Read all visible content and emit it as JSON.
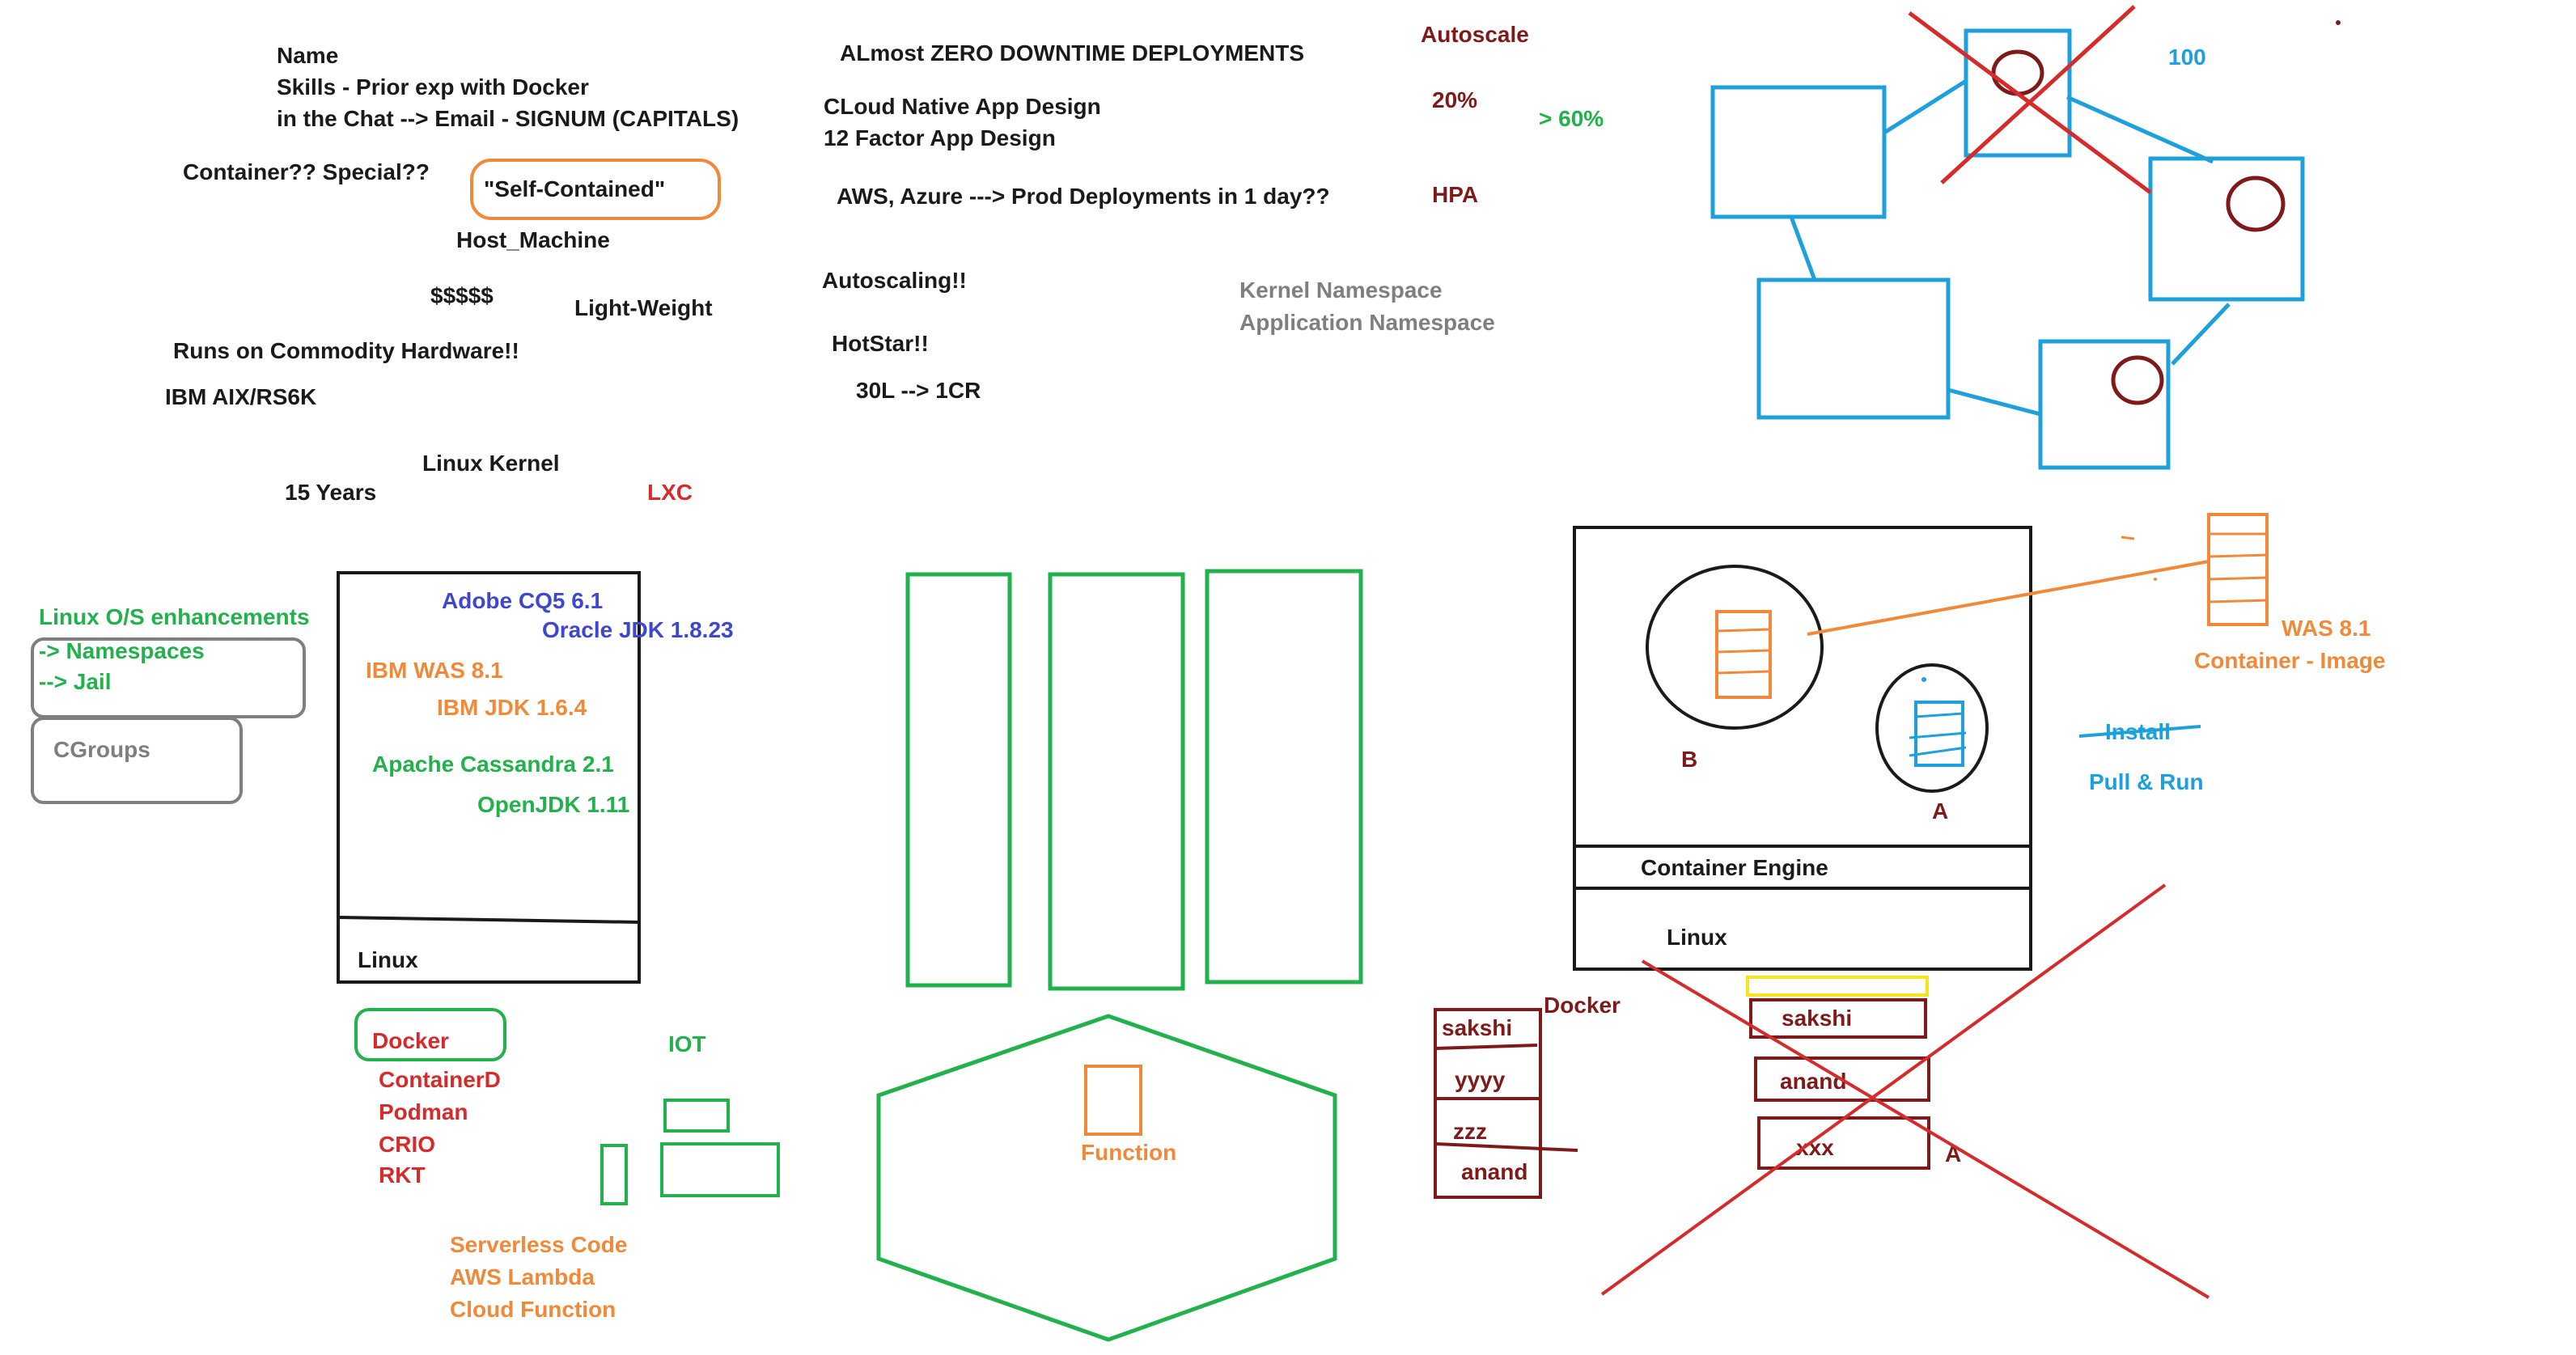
{
  "colors": {
    "black": "#1a1a1a",
    "blue_dark": "#3f48cc",
    "orange": "#f08a3a",
    "green": "#22b14c",
    "red": "#d52b2b",
    "maroon": "#7f1a1a",
    "gray": "#7f7f7f",
    "cyan": "#1ea0dc",
    "yellow": "#f5e51f"
  },
  "notes": {
    "name": "Name",
    "skills": "Skills - Prior exp with Docker",
    "chat": "in the Chat --> Email - SIGNUM (CAPITALS)",
    "container_special": "Container?? Special??",
    "self_contained": "\"Self-Contained\"",
    "host_machine": "Host_Machine",
    "dollars": "$$$$$",
    "light_weight": "Light-Weight",
    "commodity": "Runs on Commodity Hardware!!",
    "ibm_aix": "IBM AIX/RS6K",
    "linux_kernel": "Linux Kernel",
    "fifteen_years": "15 Years",
    "lxc": "LXC",
    "zero_downtime": "ALmost ZERO DOWNTIME DEPLOYMENTS",
    "cloud_native": "CLoud Native App Design",
    "twelve_factor": "12 Factor App Design",
    "aws_azure": "AWS, Azure ---> Prod Deployments in 1 day??",
    "autoscaling": "Autoscaling!!",
    "hotstar": "HotStar!!",
    "thirty_l": "30L --> 1CR",
    "autoscale": "Autoscale",
    "twenty_pct": "20%",
    "sixty_pct": "> 60%",
    "hpa": "HPA",
    "kernel_ns": "Kernel Namespace",
    "app_ns": "Application Namespace",
    "hundred": "100"
  },
  "linux_enhancements": {
    "title": "Linux O/S enhancements",
    "namespaces": "-> Namespaces",
    "jail": "--> Jail",
    "cgroups": "CGroups"
  },
  "host_stack": {
    "adobe": "Adobe CQ5 6.1",
    "oracle_jdk": "Oracle JDK 1.8.23",
    "ibm_was": "IBM WAS 8.1",
    "ibm_jdk": "IBM JDK 1.6.4",
    "cassandra": "Apache Cassandra 2.1",
    "openjdk": "OpenJDK 1.11",
    "linux": "Linux"
  },
  "runtimes": {
    "docker": "Docker",
    "containerd": "ContainerD",
    "podman": "Podman",
    "crio": "CRIO",
    "rkt": "RKT",
    "iot": "IOT"
  },
  "serverless": {
    "function": "Function",
    "serverless_code": "Serverless Code",
    "aws_lambda": "AWS Lambda",
    "cloud_function": "Cloud Function"
  },
  "engine": {
    "container_engine": "Container Engine",
    "linux": "Linux",
    "label_b": "B",
    "label_a": "A",
    "was": "WAS 8.1",
    "container_image": "Container - Image",
    "install": "Install",
    "pull_run": "Pull & Run"
  },
  "layers": {
    "docker": "Docker",
    "left": [
      "sakshi",
      "yyyy",
      "zzz",
      "anand"
    ],
    "right": [
      "sakshi",
      "anand",
      "xxx"
    ],
    "label_a": "A"
  }
}
